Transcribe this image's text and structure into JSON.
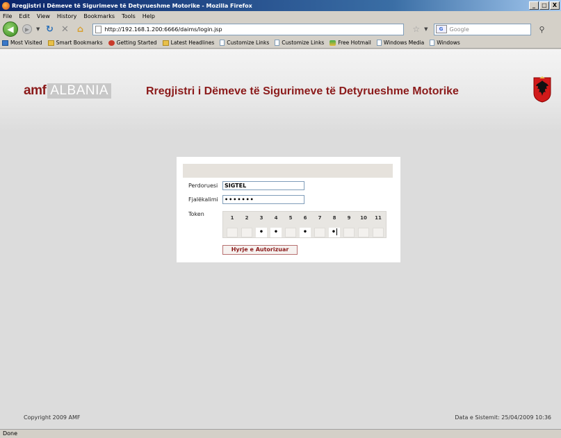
{
  "window": {
    "title": "Rregjistri i Dëmeve të Sigurimeve të Detyrueshme Motorike - Mozilla Firefox",
    "buttons": [
      "_",
      "□",
      "X"
    ]
  },
  "menu": [
    "File",
    "Edit",
    "View",
    "History",
    "Bookmarks",
    "Tools",
    "Help"
  ],
  "nav": {
    "url": "http://192.168.1.200:6666/daims/login.jsp",
    "search_placeholder": "Google"
  },
  "bookmarks": [
    {
      "label": "Most Visited",
      "icon": "blue"
    },
    {
      "label": "Smart Bookmarks",
      "icon": "folder"
    },
    {
      "label": "Getting Started",
      "icon": "red"
    },
    {
      "label": "Latest Headlines",
      "icon": "folder"
    },
    {
      "label": "Customize Links",
      "icon": "page"
    },
    {
      "label": "Customize Links",
      "icon": "page"
    },
    {
      "label": "Free Hotmail",
      "icon": "msn"
    },
    {
      "label": "Windows Media",
      "icon": "page"
    },
    {
      "label": "Windows",
      "icon": "page"
    }
  ],
  "page": {
    "logo_amf": "amf",
    "logo_albania": "ALBANIA",
    "title": "Rregjistri i Dëmeve të Sigurimeve të Detyrueshme Motorike",
    "login": {
      "user_label": "Perdoruesi",
      "user_value": "SIGTEL",
      "password_label": "Fjalëkalimi",
      "password_value": "•••••••",
      "token_label": "Token",
      "token_digits": [
        "1",
        "2",
        "3",
        "4",
        "5",
        "6",
        "7",
        "8",
        "9",
        "10",
        "11"
      ],
      "token_values": [
        "",
        "",
        "•",
        "•",
        "",
        "•",
        "",
        "•",
        "",
        "",
        ""
      ],
      "submit_label": "Hyrje e Autorizuar"
    },
    "copyright": "Copyright 2009 AMF",
    "system_date": "Data e Sistemit: 25/04/2009 10:36"
  },
  "status": "Done",
  "colors": {
    "brand": "#8b1a1a",
    "page_bg": "#dcdcdc"
  }
}
